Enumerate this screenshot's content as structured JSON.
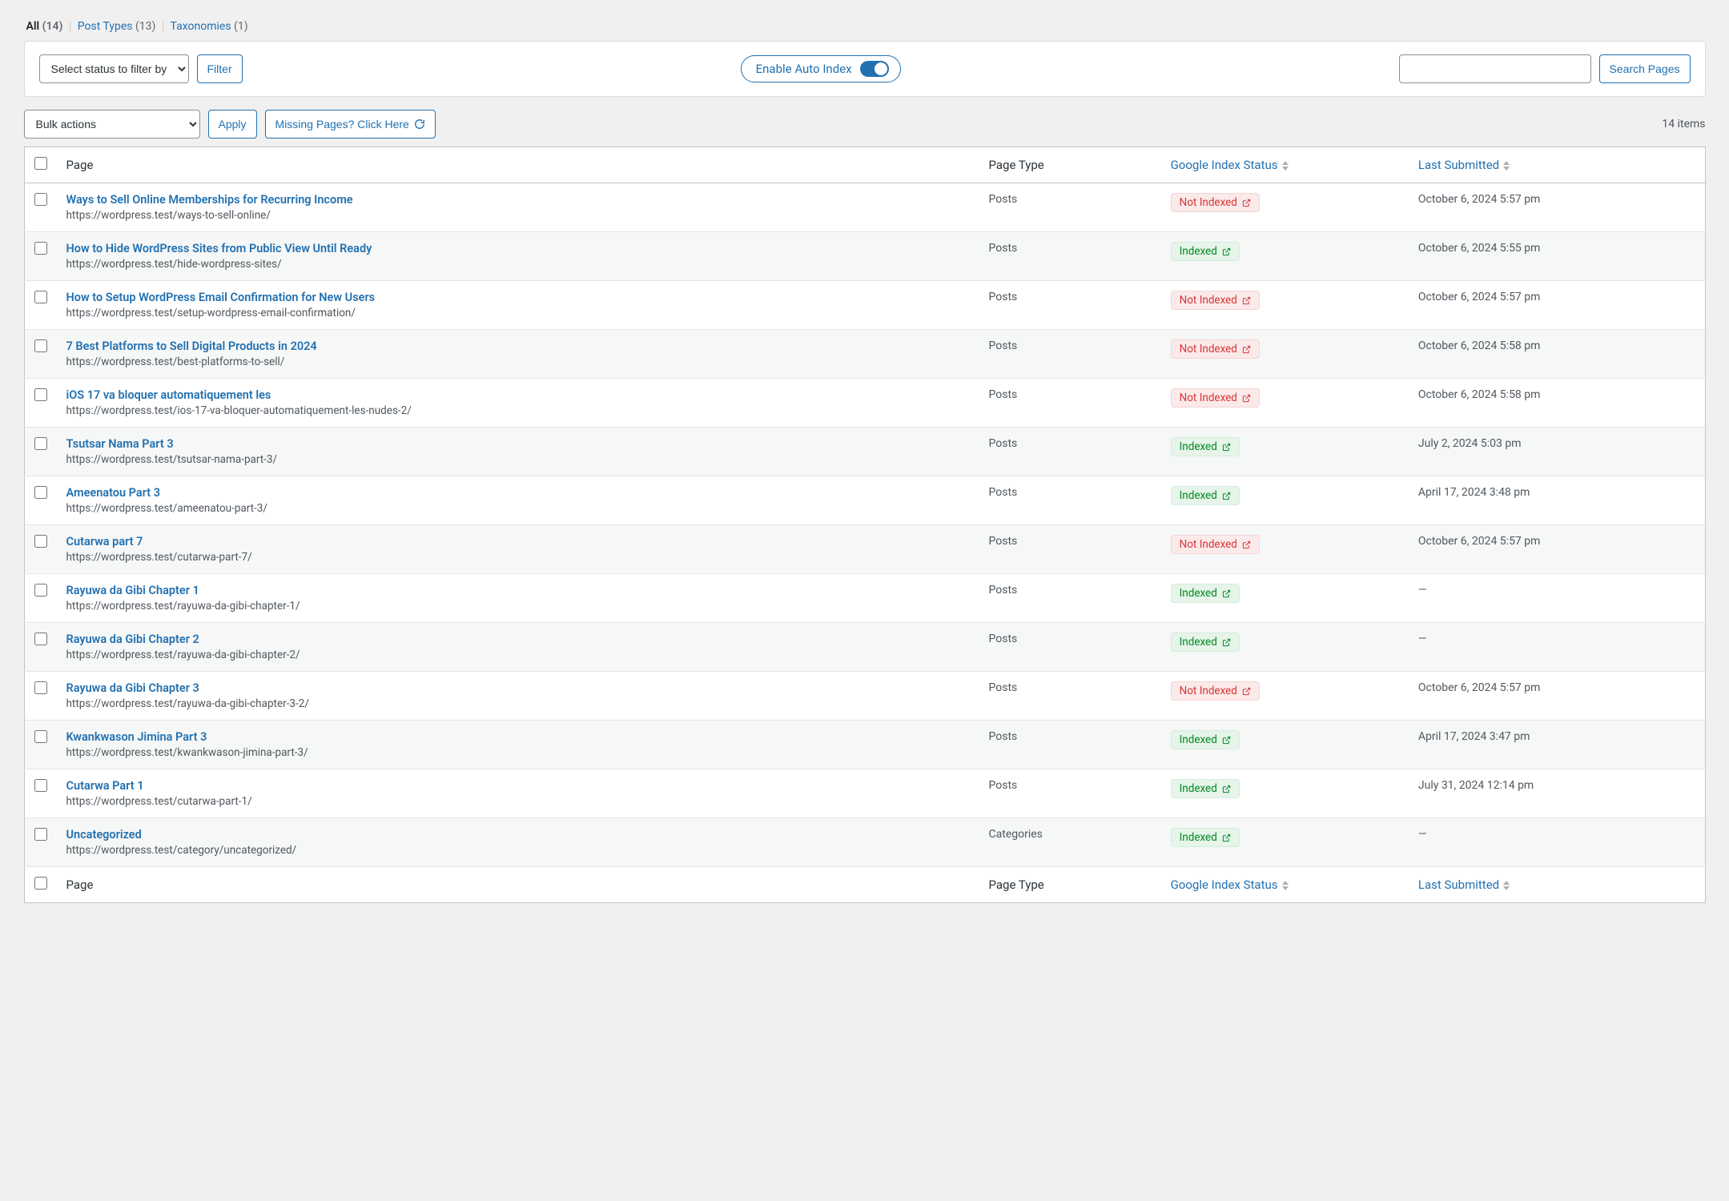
{
  "tabs": {
    "all_label": "All",
    "all_count": "(14)",
    "post_types_label": "Post Types",
    "post_types_count": "(13)",
    "taxonomies_label": "Taxonomies",
    "taxonomies_count": "(1)"
  },
  "toolbar": {
    "status_filter_label": "Select status to filter by",
    "filter_button": "Filter",
    "auto_index_label": "Enable Auto Index",
    "search_button": "Search Pages"
  },
  "bulk": {
    "bulk_label": "Bulk actions",
    "apply_label": "Apply",
    "missing_label": "Missing Pages? Click Here",
    "items_count": "14 items"
  },
  "columns": {
    "page": "Page",
    "page_type": "Page Type",
    "google_index": "Google Index Status",
    "last_submitted": "Last Submitted"
  },
  "status_labels": {
    "indexed": "Indexed",
    "not_indexed": "Not Indexed"
  },
  "rows": [
    {
      "title": "Ways to Sell Online Memberships for Recurring Income",
      "url": "https://wordpress.test/ways-to-sell-online/",
      "type": "Posts",
      "status": "not_indexed",
      "date": "October 6, 2024 5:57 pm"
    },
    {
      "title": "How to Hide WordPress Sites from Public View Until Ready",
      "url": "https://wordpress.test/hide-wordpress-sites/",
      "type": "Posts",
      "status": "indexed",
      "date": "October 6, 2024 5:55 pm"
    },
    {
      "title": "How to Setup WordPress Email Confirmation for New Users",
      "url": "https://wordpress.test/setup-wordpress-email-confirmation/",
      "type": "Posts",
      "status": "not_indexed",
      "date": "October 6, 2024 5:57 pm"
    },
    {
      "title": "7 Best Platforms to Sell Digital Products in 2024",
      "url": "https://wordpress.test/best-platforms-to-sell/",
      "type": "Posts",
      "status": "not_indexed",
      "date": "October 6, 2024 5:58 pm"
    },
    {
      "title": "iOS 17 va bloquer automatiquement les",
      "url": "https://wordpress.test/ios-17-va-bloquer-automatiquement-les-nudes-2/",
      "type": "Posts",
      "status": "not_indexed",
      "date": "October 6, 2024 5:58 pm"
    },
    {
      "title": "Tsutsar Nama Part 3",
      "url": "https://wordpress.test/tsutsar-nama-part-3/",
      "type": "Posts",
      "status": "indexed",
      "date": "July 2, 2024 5:03 pm"
    },
    {
      "title": "Ameenatou Part 3",
      "url": "https://wordpress.test/ameenatou-part-3/",
      "type": "Posts",
      "status": "indexed",
      "date": "April 17, 2024 3:48 pm"
    },
    {
      "title": "Cutarwa part 7",
      "url": "https://wordpress.test/cutarwa-part-7/",
      "type": "Posts",
      "status": "not_indexed",
      "date": "October 6, 2024 5:57 pm"
    },
    {
      "title": "Rayuwa da Gibi Chapter 1",
      "url": "https://wordpress.test/rayuwa-da-gibi-chapter-1/",
      "type": "Posts",
      "status": "indexed",
      "date": "—"
    },
    {
      "title": "Rayuwa da Gibi Chapter 2",
      "url": "https://wordpress.test/rayuwa-da-gibi-chapter-2/",
      "type": "Posts",
      "status": "indexed",
      "date": "—"
    },
    {
      "title": "Rayuwa da Gibi Chapter 3",
      "url": "https://wordpress.test/rayuwa-da-gibi-chapter-3-2/",
      "type": "Posts",
      "status": "not_indexed",
      "date": "October 6, 2024 5:57 pm"
    },
    {
      "title": "Kwankwason Jimina Part 3",
      "url": "https://wordpress.test/kwankwason-jimina-part-3/",
      "type": "Posts",
      "status": "indexed",
      "date": "April 17, 2024 3:47 pm"
    },
    {
      "title": "Cutarwa Part 1",
      "url": "https://wordpress.test/cutarwa-part-1/",
      "type": "Posts",
      "status": "indexed",
      "date": "July 31, 2024 12:14 pm"
    },
    {
      "title": "Uncategorized",
      "url": "https://wordpress.test/category/uncategorized/",
      "type": "Categories",
      "status": "indexed",
      "date": "—"
    }
  ]
}
